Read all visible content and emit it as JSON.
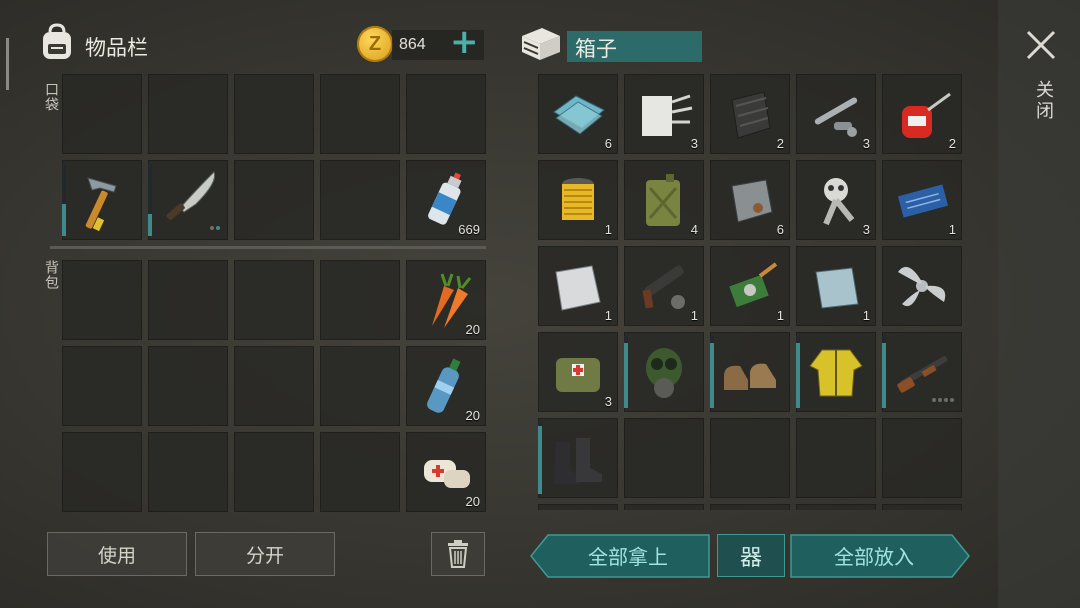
{
  "inventory": {
    "title": "物品栏",
    "coins": "864",
    "coin_symbol": "Z",
    "plus": "+",
    "pocket_label": "口袋",
    "backpack_label": "背包",
    "pockets": [
      {
        "name": "hammer",
        "count": "",
        "durability": 0.45
      },
      {
        "name": "machete",
        "count": "",
        "durability": 0.3,
        "dots": [
          false,
          true
        ]
      },
      {
        "name": "empty",
        "count": ""
      },
      {
        "name": "empty",
        "count": ""
      },
      {
        "name": "spray-can",
        "count": "669"
      }
    ],
    "backpack": [
      {
        "name": "carrots",
        "count": "20"
      },
      {
        "name": "water-bottle",
        "count": "20"
      },
      {
        "name": "bandage",
        "count": "20"
      }
    ]
  },
  "buttons": {
    "use": "使用",
    "split": "分开",
    "take_all": "全部拿上",
    "grid_icon": "器",
    "put_all": "全部放入"
  },
  "box": {
    "title": "箱子",
    "items": [
      {
        "name": "glass",
        "count": "6"
      },
      {
        "name": "fabric",
        "count": "3"
      },
      {
        "name": "rubber",
        "count": "2"
      },
      {
        "name": "pipe-parts",
        "count": "3"
      },
      {
        "name": "oil-can",
        "count": "2"
      },
      {
        "name": "filter",
        "count": "1"
      },
      {
        "name": "jerrycan",
        "count": "4"
      },
      {
        "name": "scrap-metal",
        "count": "6"
      },
      {
        "name": "engine-parts",
        "count": "3"
      },
      {
        "name": "circuit-board",
        "count": "1"
      },
      {
        "name": "steel-plate",
        "count": "1"
      },
      {
        "name": "rifle-parts",
        "count": "1"
      },
      {
        "name": "electronics",
        "count": "1"
      },
      {
        "name": "metal-plate",
        "count": "1"
      },
      {
        "name": "propeller",
        "count": ""
      },
      {
        "name": "medkit-bag",
        "count": "3"
      },
      {
        "name": "gas-mask",
        "count": "",
        "durability": 0.9
      },
      {
        "name": "leather-shoes",
        "count": "",
        "durability": 0.9
      },
      {
        "name": "yellow-jacket",
        "count": "",
        "durability": 0.9
      },
      {
        "name": "shotgun",
        "count": "",
        "durability": 0.9,
        "dots": [
          false,
          false,
          false,
          false
        ]
      },
      {
        "name": "combat-boots",
        "count": "",
        "durability": 0.95
      }
    ]
  },
  "close": {
    "icon": "close-icon",
    "label": "关闭"
  },
  "colors": {
    "accent": "#3f8b8c",
    "teal_button": "#1f5f5e",
    "coin": "#e4b12a"
  }
}
